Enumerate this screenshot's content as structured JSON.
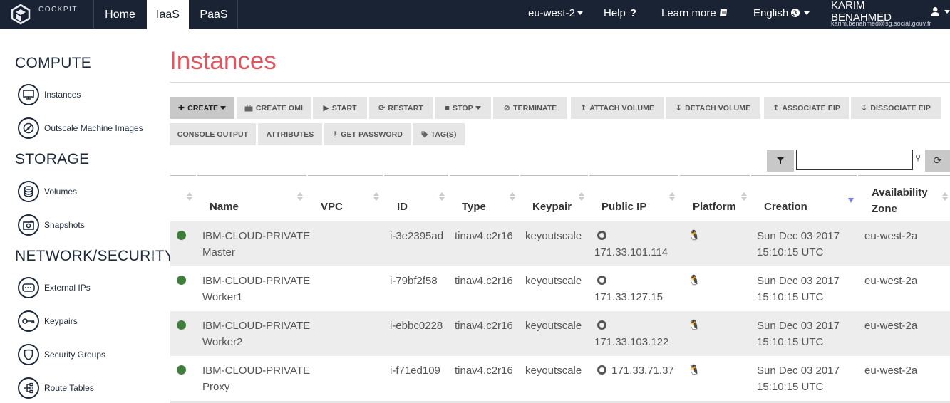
{
  "nav": {
    "logo_text": "COCKPIT",
    "tabs": [
      {
        "label": "Home",
        "active": false
      },
      {
        "label": "IaaS",
        "active": true
      },
      {
        "label": "PaaS",
        "active": false
      }
    ],
    "region": "eu-west-2",
    "help": "Help",
    "learn_more": "Learn more",
    "language": "English",
    "user_name": "KARIM BENAHMED",
    "user_email": "karim.benahmed@sg.social.gouv.fr"
  },
  "sidebar": {
    "sections": [
      {
        "heading": "COMPUTE",
        "items": [
          {
            "label": "Instances",
            "icon": "monitor-icon"
          },
          {
            "label": "Outscale Machine Images",
            "icon": "disc-icon"
          }
        ]
      },
      {
        "heading": "STORAGE",
        "items": [
          {
            "label": "Volumes",
            "icon": "database-icon"
          },
          {
            "label": "Snapshots",
            "icon": "camera-icon"
          }
        ]
      },
      {
        "heading": "NETWORK/SECURITY",
        "items": [
          {
            "label": "External IPs",
            "icon": "network-icon"
          },
          {
            "label": "Keypairs",
            "icon": "key-icon"
          },
          {
            "label": "Security Groups",
            "icon": "shield-icon"
          },
          {
            "label": "Route Tables",
            "icon": "route-icon"
          }
        ]
      }
    ]
  },
  "main": {
    "title": "Instances",
    "toolbar_row1": [
      {
        "label": "CREATE",
        "icon": "plus-icon",
        "dropdown": true,
        "active": true
      },
      {
        "label": "CREATE OMI",
        "icon": "briefcase-icon"
      },
      {
        "label": "START",
        "icon": "play-icon"
      },
      {
        "label": "RESTART",
        "icon": "refresh-icon"
      },
      {
        "label": "STOP",
        "icon": "stop-icon",
        "dropdown": true
      },
      {
        "label": "TERMINATE",
        "icon": "ban-icon"
      },
      {
        "label": "ATTACH VOLUME",
        "icon": "arrow-up-icon"
      },
      {
        "label": "DETACH VOLUME",
        "icon": "arrow-down-icon"
      },
      {
        "label": "ASSOCIATE EIP",
        "icon": "arrow-up-icon"
      },
      {
        "label": "DISSOCIATE EIP",
        "icon": "arrow-down-icon"
      }
    ],
    "toolbar_row2": [
      {
        "label": "CONSOLE OUTPUT"
      },
      {
        "label": "ATTRIBUTES"
      },
      {
        "label": "GET PASSWORD",
        "icon": "key-icon"
      },
      {
        "label": "TAG(S)",
        "icon": "tag-icon"
      }
    ],
    "search": {
      "value": "",
      "placeholder": ""
    },
    "table": {
      "columns": [
        "",
        "Name",
        "VPC",
        "ID",
        "Type",
        "Keypair",
        "Public IP",
        "Platform",
        "Creation",
        "Availability Zone"
      ],
      "availability_zone_lines": [
        "Availability",
        "Zone"
      ],
      "sorted_column": "Creation",
      "rows": [
        {
          "status_color": "#3e7d3a",
          "name_lines": [
            "IBM-CLOUD-PRIVATE",
            "Master"
          ],
          "vpc": "",
          "id": "i-3e2395ad",
          "type": "tinav4.c2r16",
          "keypair": "keyoutscale",
          "public_ip": "171.33.101.114",
          "platform": "linux-icon",
          "creation_lines": [
            "Sun Dec 03 2017",
            "15:10:15 UTC"
          ],
          "zone": "eu-west-2a"
        },
        {
          "status_color": "#3e7d3a",
          "name_lines": [
            "IBM-CLOUD-PRIVATE",
            "Worker1"
          ],
          "vpc": "",
          "id": "i-79bf2f58",
          "type": "tinav4.c2r16",
          "keypair": "keyoutscale",
          "public_ip": "171.33.127.15",
          "platform": "linux-icon",
          "creation_lines": [
            "Sun Dec 03 2017",
            "15:10:15 UTC"
          ],
          "zone": "eu-west-2a"
        },
        {
          "status_color": "#3e7d3a",
          "name_lines": [
            "IBM-CLOUD-PRIVATE",
            "Worker2"
          ],
          "vpc": "",
          "id": "i-ebbc0228",
          "type": "tinav4.c2r16",
          "keypair": "keyoutscale",
          "public_ip": "171.33.103.122",
          "platform": "linux-icon",
          "creation_lines": [
            "Sun Dec 03 2017",
            "15:10:15 UTC"
          ],
          "zone": "eu-west-2a"
        },
        {
          "status_color": "#3e7d3a",
          "name_lines": [
            "IBM-CLOUD-PRIVATE",
            "Proxy"
          ],
          "vpc": "",
          "id": "i-f71ed109",
          "type": "tinav4.c2r16",
          "keypair": "keyoutscale",
          "public_ip": "171.33.71.37",
          "platform": "linux-icon",
          "creation_lines": [
            "Sun Dec 03 2017",
            "15:10:15 UTC"
          ],
          "zone": "eu-west-2a"
        }
      ]
    }
  }
}
